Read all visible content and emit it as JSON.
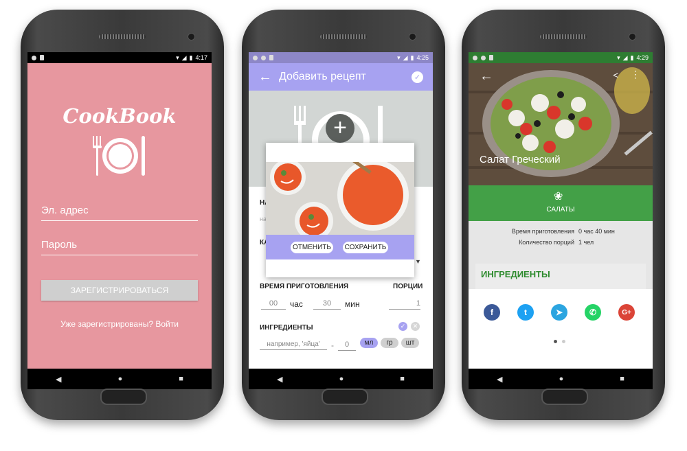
{
  "screen1": {
    "time": "4:17",
    "logo": "CookBook",
    "email_placeholder": "Эл. адрес",
    "password_placeholder": "Пароль",
    "register_button": "ЗАРЕГИСТРИРОВАТЬСЯ",
    "login_link": "Уже зарегистрированы? Войти",
    "background_color": "#e7979f"
  },
  "screen2": {
    "time": "4:25",
    "title": "Добавить рецепт",
    "field_labels_partial": [
      "НА",
      "КА"
    ],
    "name_placeholder_partial": "на",
    "cancel_button": "ОТМЕНИТЬ",
    "save_button": "СОХРАНИТЬ",
    "prep_time_label": "ВРЕМЯ ПРИГОТОВЛЕНИЯ",
    "portions_label": "ПОРЦИИ",
    "hours_value": "00",
    "hours_unit": "час",
    "minutes_value": "30",
    "minutes_unit": "мин",
    "portions_value": "1",
    "ingredients_label": "ИНГРЕДИЕНТЫ",
    "ingredient_placeholder": "например, 'яйца'",
    "dash": "-",
    "amount_value": "0",
    "units": [
      "мл",
      "гр",
      "шт"
    ],
    "accent_color": "#a7a2f1"
  },
  "screen3": {
    "time": "4:29",
    "dish_title": "Салат Греческий",
    "category": "САЛАТЫ",
    "prep_time_label": "Время приготовления",
    "prep_time_value": "0 час 40 мин",
    "portions_label": "Количество порций",
    "portions_value": "1 чел",
    "ingredients_header": "ИНГРЕДИЕНТЫ",
    "share_icons": [
      "facebook-icon",
      "twitter-icon",
      "telegram-icon",
      "whatsapp-icon",
      "google-plus-icon"
    ],
    "accent_color": "#43a047"
  },
  "nav": {
    "back": "◀",
    "home": "●",
    "recent": "■"
  }
}
